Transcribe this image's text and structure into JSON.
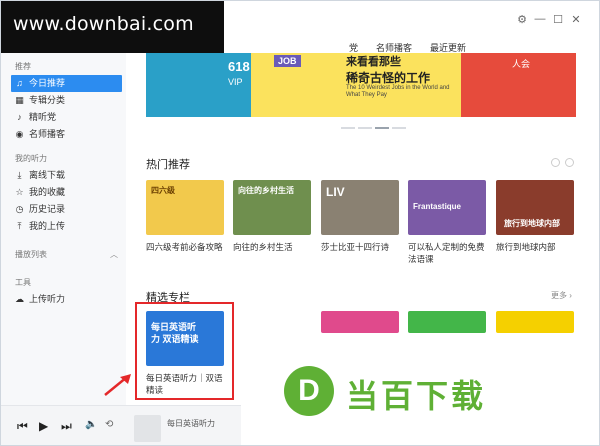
{
  "watermark": "www.downbai.com",
  "window_controls": {
    "settings": "⚙",
    "minimize": "—",
    "maximize": "☐",
    "close": "✕"
  },
  "nav_tabs": [
    "党",
    "名师播客",
    "最近更新"
  ],
  "sidebar": {
    "group_recommend": "推荐",
    "items_recommend": [
      {
        "label": "今日推荐",
        "icon": "♫"
      },
      {
        "label": "专辑分类",
        "icon": "▦"
      },
      {
        "label": "精听党",
        "icon": "♪"
      },
      {
        "label": "名师播客",
        "icon": "◉"
      }
    ],
    "group_mine": "我的听力",
    "items_mine": [
      {
        "label": "离线下载",
        "icon": "⤓"
      },
      {
        "label": "我的收藏",
        "icon": "☆"
      },
      {
        "label": "历史记录",
        "icon": "◷"
      },
      {
        "label": "我的上传",
        "icon": "⤒"
      }
    ],
    "group_playlist": "播放列表",
    "group_tools": "工具",
    "items_tools": [
      {
        "label": "上传听力",
        "icon": "☁"
      }
    ]
  },
  "banner": {
    "promo_number": "618",
    "promo_vip": "VIP",
    "job_tag": "JOB",
    "title": "稀奇古怪的工作",
    "title_top": "来看看那些",
    "subtitle": "The 10 Weirdest Jobs in the World and What They Pay",
    "right_text": "人会"
  },
  "section_hot": {
    "title": "热门推荐",
    "cards": [
      {
        "caption": "四六级考前必备攻略",
        "cover_text": "四六级",
        "color": "#f2c94c"
      },
      {
        "caption": "向往的乡村生活",
        "cover_text": "向往的乡村生活",
        "color": "#6f8f4e"
      },
      {
        "caption": "莎士比亚十四行诗",
        "cover_text": "LIV",
        "color": "#8a8172"
      },
      {
        "caption": "可以私人定制的免费法语课",
        "cover_text": "Frantastique",
        "color": "#7b5aa6"
      },
      {
        "caption": "旅行到地球内部",
        "cover_text": "旅行到地球内部",
        "color": "#8a3c2c"
      }
    ]
  },
  "section_featured": {
    "title": "精选专栏",
    "more": "更多 ›",
    "cards": [
      {
        "caption": "每日英语听力｜双语精读",
        "cover_text": "每日英语听力 双语精读",
        "color": "#2a78d8"
      },
      {
        "caption": "",
        "cover_text": "",
        "color": "#e04a8c"
      },
      {
        "caption": "",
        "cover_text": "",
        "color": "#43b649"
      },
      {
        "caption": "",
        "cover_text": "",
        "color": "#f5d000"
      }
    ]
  },
  "player": {
    "now_playing": "每日英语听力"
  },
  "logo": {
    "mark": "D",
    "text": "当百下载"
  }
}
